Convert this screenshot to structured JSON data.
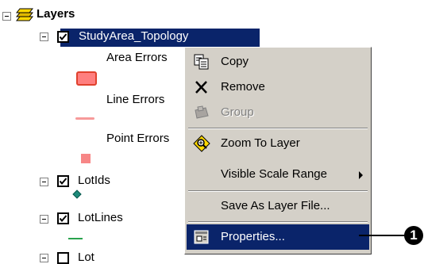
{
  "tree": {
    "root_label": "Layers",
    "topology_layer": "StudyArea_Topology",
    "legend": [
      "Area Errors",
      "Line Errors",
      "Point Errors"
    ],
    "layers": [
      "LotIds",
      "LotLines",
      "Lot"
    ]
  },
  "context_menu": {
    "items": [
      {
        "label": "Copy",
        "icon": "copy-icon",
        "enabled": true
      },
      {
        "label": "Remove",
        "icon": "remove-x-icon",
        "enabled": true
      },
      {
        "label": "Group",
        "icon": "group-icon",
        "enabled": false
      },
      {
        "label": "Zoom To Layer",
        "icon": "zoom-to-layer-icon",
        "enabled": true
      },
      {
        "label": "Visible Scale Range",
        "icon": "",
        "enabled": true,
        "submenu": true
      },
      {
        "label": "Save As Layer File...",
        "icon": "",
        "enabled": true
      },
      {
        "label": "Properties...",
        "icon": "properties-icon",
        "enabled": true,
        "highlighted": true
      }
    ]
  },
  "callout": {
    "number": "1"
  },
  "colors": {
    "selection": "#0a246a",
    "menu_background": "#d4d0c8",
    "area_error": "#ff7f7f",
    "line_error": "#f79a9a",
    "point_error": "#f78686"
  }
}
